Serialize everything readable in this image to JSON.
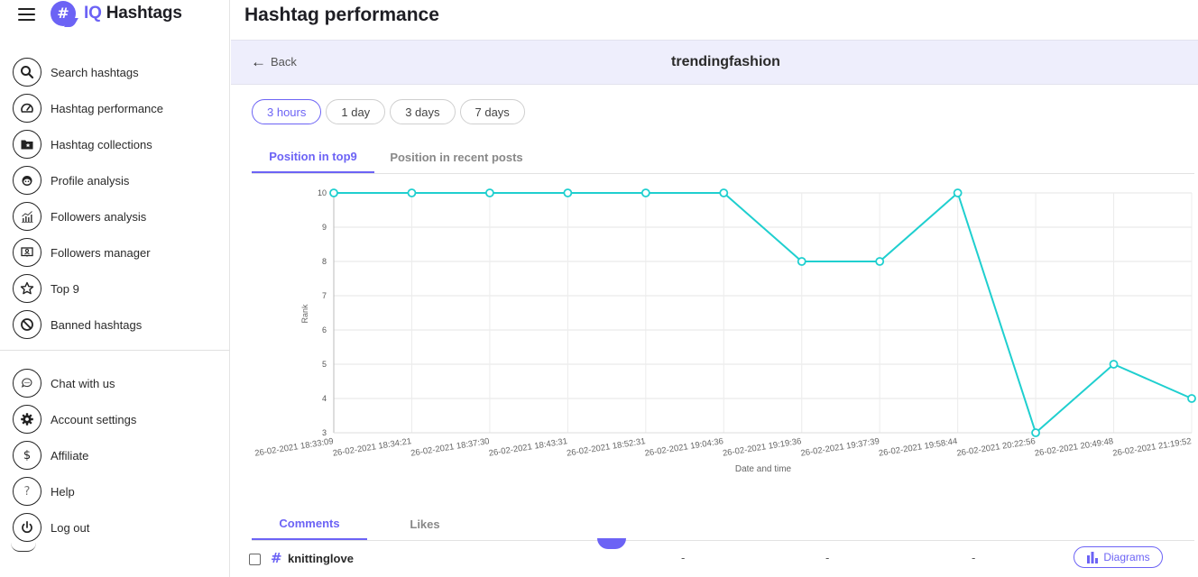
{
  "app": {
    "name_part1": "IQ",
    "name_part2": "Hashtags",
    "logo_glyph": "#"
  },
  "sidebar": {
    "top_items": [
      {
        "label": "Search hashtags",
        "icon": "search-icon"
      },
      {
        "label": "Hashtag performance",
        "icon": "gauge-icon"
      },
      {
        "label": "Hashtag collections",
        "icon": "folder-star-icon"
      },
      {
        "label": "Profile analysis",
        "icon": "face-icon"
      },
      {
        "label": "Followers analysis",
        "icon": "growth-chart-icon"
      },
      {
        "label": "Followers manager",
        "icon": "user-screen-icon"
      },
      {
        "label": "Top 9",
        "icon": "star-icon"
      },
      {
        "label": "Banned hashtags",
        "icon": "ban-icon"
      }
    ],
    "bottom_items": [
      {
        "label": "Chat with us",
        "icon": "chat-icon"
      },
      {
        "label": "Account settings",
        "icon": "gear-icon"
      },
      {
        "label": "Affiliate",
        "icon": "dollar-icon",
        "glyph": "$"
      },
      {
        "label": "Help",
        "icon": "question-icon",
        "glyph": "?"
      },
      {
        "label": "Log out",
        "icon": "power-icon"
      }
    ]
  },
  "main": {
    "page_title": "Hashtag performance",
    "back_label": "Back",
    "back_arrow": "←",
    "hashtag": "trendingfashion",
    "ranges": [
      {
        "label": "3 hours",
        "active": true
      },
      {
        "label": "1 day",
        "active": false
      },
      {
        "label": "3 days",
        "active": false
      },
      {
        "label": "7 days",
        "active": false
      }
    ],
    "chart_tabs": [
      {
        "label": "Position in top9",
        "active": true
      },
      {
        "label": "Position in recent posts",
        "active": false
      }
    ],
    "metric_tabs": [
      {
        "label": "Comments",
        "active": true
      },
      {
        "label": "Likes",
        "active": false
      }
    ],
    "row": {
      "hash_glyph": "#",
      "tag": "knittinglove",
      "values": [
        "-",
        "-",
        "-"
      ],
      "diagrams_label": "Diagrams"
    }
  },
  "colors": {
    "accent": "#6c63f5",
    "line": "#1fcfcf",
    "band": "#eeeefc"
  },
  "chart_data": {
    "type": "line",
    "title": "",
    "xlabel": "Date and time",
    "ylabel": "Rank",
    "ylim": [
      3,
      10
    ],
    "yticks": [
      3,
      4,
      5,
      6,
      7,
      8,
      9,
      10
    ],
    "grid": true,
    "legend": "none",
    "x": [
      "26-02-2021 18:33:09",
      "26-02-2021 18:34:21",
      "26-02-2021 18:37:30",
      "26-02-2021 18:43:31",
      "26-02-2021 18:52:31",
      "26-02-2021 19:04:36",
      "26-02-2021 19:19:36",
      "26-02-2021 19:37:39",
      "26-02-2021 19:58:44",
      "26-02-2021 20:22:56",
      "26-02-2021 20:49:48",
      "26-02-2021 21:19:52"
    ],
    "series": [
      {
        "name": "Rank",
        "values": [
          10,
          10,
          10,
          10,
          10,
          10,
          8,
          8,
          10,
          3,
          5,
          4
        ]
      }
    ]
  }
}
